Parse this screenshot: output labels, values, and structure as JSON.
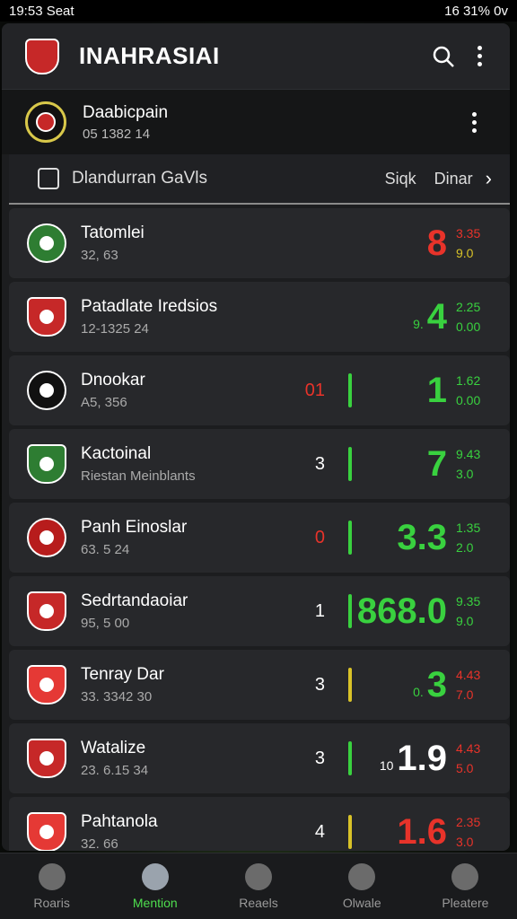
{
  "status": {
    "time": "19:53 Seat",
    "right": "16 31% 0v"
  },
  "appbar": {
    "title": "INAHRASIAI",
    "crest_color": "#c62828"
  },
  "league": {
    "name": "Daabicpain",
    "sub": "05 1382 14"
  },
  "subhead": {
    "label": "Dlandurran GaVls",
    "col1": "Siqk",
    "col2": "Dinar"
  },
  "colors": {
    "green": "#39d13f",
    "red": "#e8332a",
    "yellow": "#d8c228",
    "white": "#ffffff"
  },
  "rows": [
    {
      "name": "Tatomlei",
      "sub": "32, 63",
      "mid": "",
      "mid_color": "#e8332a",
      "bar": "",
      "score": "8",
      "score_prefix": "",
      "score_color": "#e8332a",
      "odd1": "3.35",
      "odd2": "9.0",
      "odd1_color": "#e8332a",
      "odd2_color": "#d8c228",
      "logo_bg": "#2e7d32",
      "logo_shape": "round"
    },
    {
      "name": "Patadlate Iredsios",
      "sub": "12-1325 24",
      "mid": "",
      "mid_color": "#39d13f",
      "bar": "",
      "score": "4",
      "score_prefix": "9.",
      "score_color": "#39d13f",
      "odd1": "2.25",
      "odd2": "0.00",
      "odd1_color": "#39d13f",
      "odd2_color": "#39d13f",
      "logo_bg": "#c62828",
      "logo_shape": "shield"
    },
    {
      "name": "Dnookar",
      "sub": "A5, 356",
      "mid": "01",
      "mid_color": "#e8332a",
      "bar": "#39d13f",
      "score": "1",
      "score_prefix": "",
      "score_color": "#39d13f",
      "odd1": "1.62",
      "odd2": "0.00",
      "odd1_color": "#39d13f",
      "odd2_color": "#39d13f",
      "logo_bg": "#111111",
      "logo_shape": "round"
    },
    {
      "name": "Kactoinal",
      "sub": "Riestan Meinblants",
      "mid": "3",
      "mid_color": "#ffffff",
      "bar": "#39d13f",
      "score": "7",
      "score_prefix": "",
      "score_color": "#39d13f",
      "odd1": "9.43",
      "odd2": "3.0",
      "odd1_color": "#39d13f",
      "odd2_color": "#39d13f",
      "logo_bg": "#2e7d32",
      "logo_shape": "shield"
    },
    {
      "name": "Panh Einoslar",
      "sub": "63. 5 24",
      "mid": "0",
      "mid_color": "#e8332a",
      "bar": "#39d13f",
      "score": "3.3",
      "score_prefix": "",
      "score_color": "#39d13f",
      "odd1": "1.35",
      "odd2": "2.0",
      "odd1_color": "#39d13f",
      "odd2_color": "#39d13f",
      "logo_bg": "#b71c1c",
      "logo_shape": "round"
    },
    {
      "name": "Sedrtandaoiar",
      "sub": "95, 5 00",
      "mid": "1",
      "mid_color": "#ffffff",
      "bar": "#39d13f",
      "score": "868.0",
      "score_prefix": "",
      "score_color": "#39d13f",
      "odd1": "9.35",
      "odd2": "9.0",
      "odd1_color": "#39d13f",
      "odd2_color": "#39d13f",
      "logo_bg": "#c62828",
      "logo_shape": "shield"
    },
    {
      "name": "Tenray Dar",
      "sub": "33. 3342 30",
      "mid": "3",
      "mid_color": "#ffffff",
      "bar": "#d8c228",
      "score": "3",
      "score_prefix": "0.",
      "score_color": "#39d13f",
      "odd1": "4.43",
      "odd2": "7.0",
      "odd1_color": "#e8332a",
      "odd2_color": "#e8332a",
      "logo_bg": "#e53935",
      "logo_shape": "shield"
    },
    {
      "name": "Watalize",
      "sub": "23. 6.15 34",
      "mid": "3",
      "mid_color": "#ffffff",
      "bar": "#39d13f",
      "score": "1.9",
      "score_prefix": "10",
      "score_color": "#ffffff",
      "odd1": "4.43",
      "odd2": "5.0",
      "odd1_color": "#e8332a",
      "odd2_color": "#e8332a",
      "logo_bg": "#c62828",
      "logo_shape": "shield"
    },
    {
      "name": "Pahtanola",
      "sub": "32. 66",
      "mid": "4",
      "mid_color": "#ffffff",
      "bar": "#d8c228",
      "score": "1.6",
      "score_prefix": "",
      "score_color": "#e8332a",
      "odd1": "2.35",
      "odd2": "3.0",
      "odd1_color": "#e8332a",
      "odd2_color": "#e8332a",
      "logo_bg": "#e53935",
      "logo_shape": "shield"
    }
  ],
  "nav": [
    {
      "label": "Roaris",
      "icon": "home-icon",
      "active": false
    },
    {
      "label": "Mention",
      "icon": "soccer-icon",
      "active": true
    },
    {
      "label": "Reaels",
      "icon": "check-icon",
      "active": false
    },
    {
      "label": "Olwale",
      "icon": "badge-icon",
      "active": false
    },
    {
      "label": "Pleatere",
      "icon": "person-icon",
      "active": false
    }
  ]
}
